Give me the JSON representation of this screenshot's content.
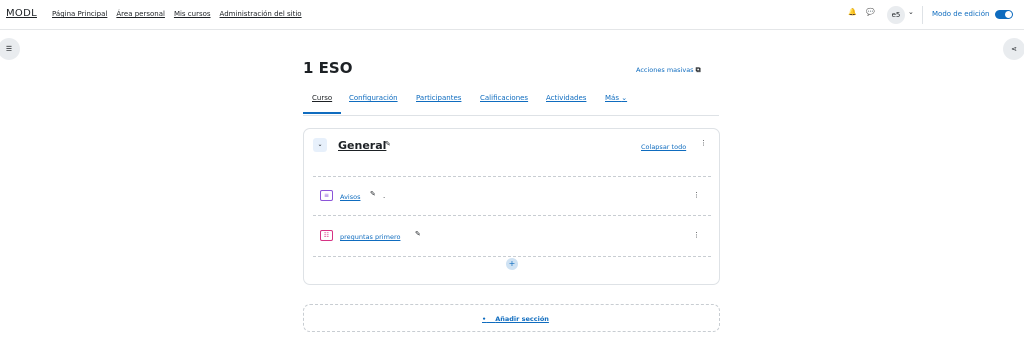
{
  "navbar": {
    "brand": "MODL",
    "links": [
      "Página Principal",
      "Área personal",
      "Mis cursos",
      "Administración del sitio"
    ],
    "notification_glyph": "🔔",
    "messages_glyph": "💬",
    "avatar_initials": "e5",
    "avatar_caret": "⌄",
    "edit_mode_label": "Modo de edición",
    "edit_mode_on": true
  },
  "drawers": {
    "left_glyph": "☰",
    "right_glyph": "⋖"
  },
  "course": {
    "title": "1 ESO",
    "bulk_actions_label": "Acciones masivas",
    "bulk_actions_glyph": "⧉"
  },
  "tabs": [
    {
      "label": "Curso",
      "active": true
    },
    {
      "label": "Configuración",
      "active": false
    },
    {
      "label": "Participantes",
      "active": false
    },
    {
      "label": "Calificaciones",
      "active": false
    },
    {
      "label": "Actividades",
      "active": false
    },
    {
      "label": "Más",
      "active": false
    }
  ],
  "tabs_more_glyph": "⌄",
  "section": {
    "collapse_glyph": "⌄",
    "title": "General",
    "title_glyph": "✎",
    "collapse_all_label": "Colapsar todo",
    "menu_glyph": "⋮",
    "add_glyph": "+"
  },
  "activities": [
    {
      "icon": "forum-icon",
      "icon_glyph": "≡",
      "name": "Avisos",
      "edit_glyph": "✎",
      "trailing": ".",
      "menu_glyph": "⋮",
      "accent": "#8c55d8"
    },
    {
      "icon": "quiz-icon",
      "icon_glyph": "☷",
      "name": "preguntas primero",
      "edit_glyph": "✎",
      "trailing": "",
      "menu_glyph": "⋮",
      "accent": "#d63384"
    }
  ],
  "add_section": {
    "bullet": "•",
    "label": "Añadir sección"
  },
  "colors": {
    "accent": "#0f6cbf",
    "toggle_on": "#0f6cbf"
  }
}
